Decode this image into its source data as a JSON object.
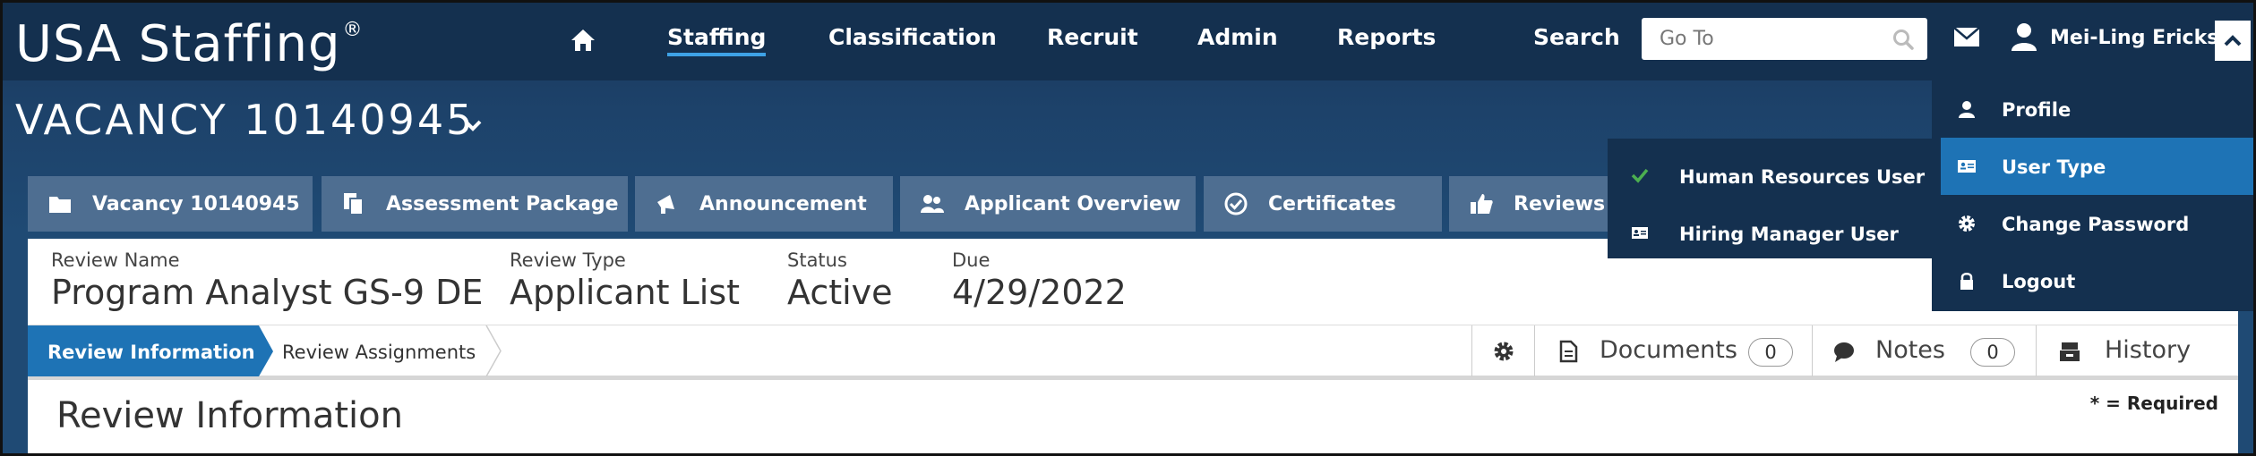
{
  "app": {
    "logo_text": "USA Staffing",
    "logo_mark": "®"
  },
  "nav": {
    "items": [
      {
        "label": "Staffing",
        "active": true
      },
      {
        "label": "Classification"
      },
      {
        "label": "Recruit"
      },
      {
        "label": "Admin"
      },
      {
        "label": "Reports"
      },
      {
        "label": "Search"
      }
    ],
    "goto_placeholder": "Go To",
    "user_name": "Mei-Ling Erickson"
  },
  "vacancy": {
    "title": "VACANCY 10140945"
  },
  "tabs": [
    {
      "label": "Vacancy 10140945",
      "icon": "folder-icon"
    },
    {
      "label": "Assessment Package",
      "icon": "documents-icon"
    },
    {
      "label": "Announcement",
      "icon": "megaphone-icon"
    },
    {
      "label": "Applicant Overview",
      "icon": "people-icon"
    },
    {
      "label": "Certificates",
      "icon": "check-circle-icon"
    },
    {
      "label": "Reviews",
      "icon": "thumbs-up-icon"
    }
  ],
  "review": {
    "fields": [
      {
        "label": "Review Name",
        "value": "Program Analyst GS-9 DE"
      },
      {
        "label": "Review Type",
        "value": "Applicant List"
      },
      {
        "label": "Status",
        "value": "Active"
      },
      {
        "label": "Due",
        "value": "4/29/2022"
      }
    ],
    "subtabs": [
      "Review Information",
      "Review Assignments"
    ],
    "tools": {
      "documents_label": "Documents",
      "documents_count": "0",
      "notes_label": "Notes",
      "notes_count": "0",
      "history_label": "History"
    },
    "section_title": "Review Information",
    "required_note": "* = Required"
  },
  "user_menu": {
    "items": [
      {
        "label": "Profile",
        "icon": "person-icon"
      },
      {
        "label": "User Type",
        "icon": "id-card-icon",
        "highlighted": true
      },
      {
        "label": "Change Password",
        "icon": "gear-icon"
      },
      {
        "label": "Logout",
        "icon": "lock-icon"
      }
    ]
  },
  "user_type_menu": {
    "items": [
      {
        "label": "Human Resources User",
        "icon": "checkmark-icon",
        "selected": true
      },
      {
        "label": "Hiring Manager User",
        "icon": "id-card-icon"
      }
    ]
  },
  "colors": {
    "top_bar": "#14304f",
    "accent_blue": "#1e73b5",
    "tab_bg": "#4e6e91",
    "nav_underline": "#3ea2e6",
    "check_green": "#4caf50"
  }
}
